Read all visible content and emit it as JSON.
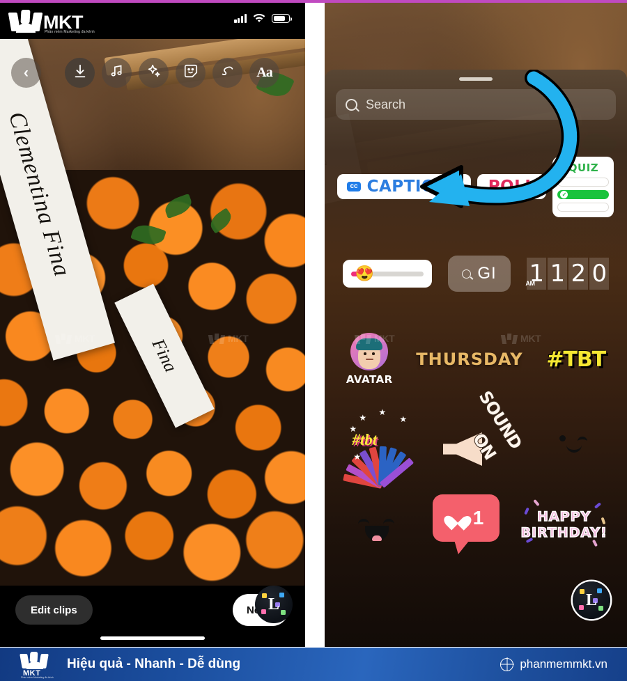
{
  "header": {
    "brand_name": "MKT",
    "brand_tagline": "Phần mềm Marketing đa kênh",
    "status_icons": [
      "signal-icon",
      "wifi-icon",
      "battery-icon"
    ]
  },
  "left_phone": {
    "photo_alt": "Clementina Fina oranges in wooden crates",
    "photo_labels": [
      "Clementina Fina",
      "Fina"
    ],
    "toolbar": [
      {
        "name": "back-button",
        "glyph": "‹"
      },
      {
        "name": "save-button",
        "glyph": "↓"
      },
      {
        "name": "music-button",
        "glyph": "♫"
      },
      {
        "name": "effects-button",
        "glyph": "✦"
      },
      {
        "name": "sticker-button",
        "glyph": "☺"
      },
      {
        "name": "draw-button",
        "glyph": "∿"
      },
      {
        "name": "text-button",
        "glyph": "Aa"
      }
    ],
    "edit_clips_label": "Edit clips",
    "next_label": "Ne"
  },
  "right_phone": {
    "search": {
      "placeholder": "Search",
      "icon": "search-icon"
    },
    "sticker_rows": [
      {
        "row": 1,
        "items": [
          {
            "name": "captions-sticker",
            "label": "CAPTIONS",
            "badge": "cc",
            "color": "#2b7de0"
          },
          {
            "name": "poll-sticker",
            "label": "POLL",
            "color": "#e0295c"
          },
          {
            "name": "quiz-sticker",
            "label": "QUIZ",
            "color": "#2fb24a",
            "options": 3,
            "selected_index": 1
          }
        ]
      },
      {
        "row": 2,
        "items": [
          {
            "name": "emoji-slider-sticker",
            "emoji": "😍"
          },
          {
            "name": "gif-search-sticker",
            "label": "GI"
          },
          {
            "name": "clock-sticker",
            "digits": [
              "1",
              "1",
              "2",
              "0"
            ],
            "meridiem": "AM"
          }
        ]
      },
      {
        "row": 3,
        "items": [
          {
            "name": "avatar-sticker",
            "label": "AVATAR"
          },
          {
            "name": "thursday-sticker",
            "label": "THURSDAY"
          },
          {
            "name": "tbt-sticker",
            "label": "#TBT"
          }
        ]
      },
      {
        "row": 4,
        "items": [
          {
            "name": "tbt-burst-sticker",
            "label": "#tbt"
          },
          {
            "name": "sound-on-sticker",
            "label_1": "SOUND",
            "label_2": "ON"
          },
          {
            "name": "blue-heart-sticker",
            "label": ""
          }
        ]
      },
      {
        "row": 5,
        "items": [
          {
            "name": "pink-heart-sticker",
            "label": ""
          },
          {
            "name": "like-count-sticker",
            "count": "1"
          },
          {
            "name": "happy-birthday-sticker",
            "line_1": "HAPPY",
            "line_2": "BIRTHDAY!"
          }
        ]
      }
    ],
    "annotation": {
      "name": "arrow-annotation",
      "color": "#23b2ef",
      "points_to": "captions-sticker"
    }
  },
  "watermark": {
    "text": "MKT"
  },
  "footer": {
    "brand_name": "MKT",
    "brand_tagline": "Phần mềm Marketing đa kênh",
    "slogan": "Hiệu quả - Nhanh - Dễ dùng",
    "website": "phanmemmkt.vn",
    "globe_icon": "globe-icon"
  },
  "colors": {
    "accent_magenta": "#c04ac0",
    "footer_blue": "#1b4e9e",
    "arrow_cyan": "#23b2ef"
  }
}
